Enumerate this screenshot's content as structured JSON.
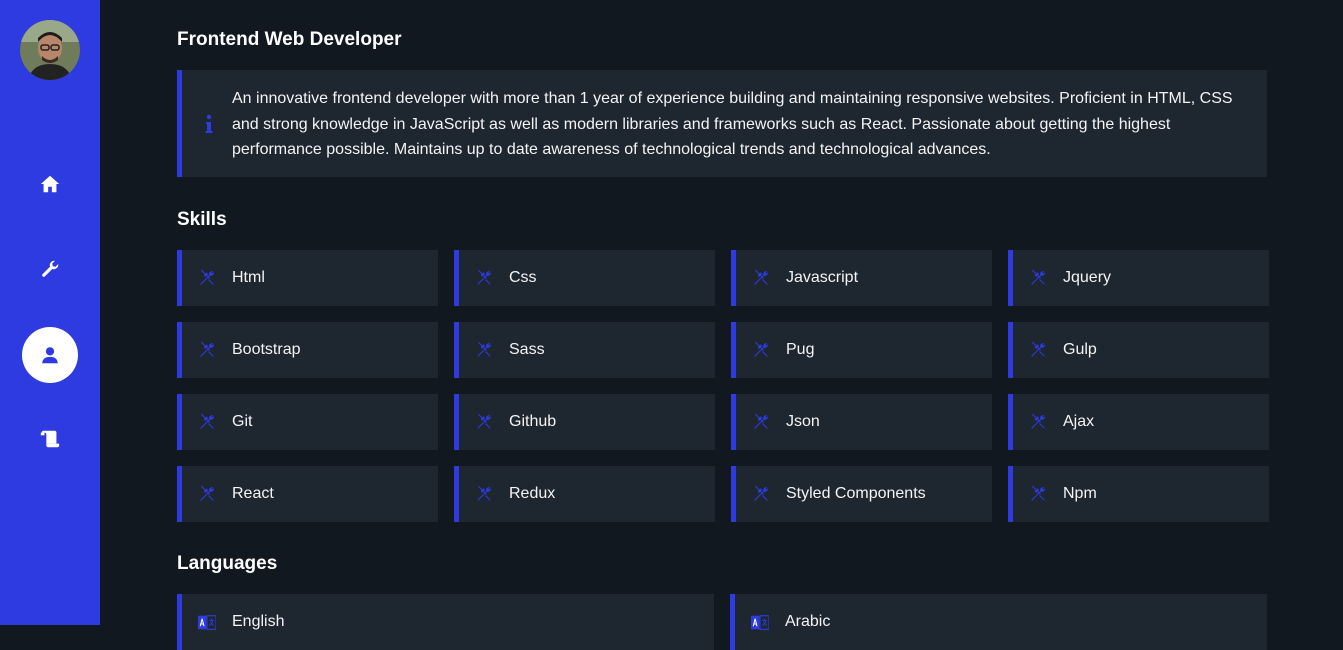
{
  "sidebar": {
    "avatar_alt": "profile photo",
    "nav": [
      {
        "name": "home",
        "icon": "home-icon"
      },
      {
        "name": "skills",
        "icon": "wrench-icon"
      },
      {
        "name": "about",
        "icon": "user-icon",
        "active": true
      },
      {
        "name": "resume",
        "icon": "scroll-icon"
      }
    ]
  },
  "profile": {
    "title": "Frontend Web Developer",
    "about_icon": "info-icon",
    "about_line1": "An innovative frontend developer with more than 1 year of experience building and maintaining responsive websites. Proficient in HTML, CSS",
    "about_line2": "and strong knowledge in JavaScript as well as modern libraries and frameworks such as React. Passionate about getting the highest",
    "about_line3": "performance possible. Maintains up to date awareness of technological trends and technological advances."
  },
  "skills": {
    "heading": "Skills",
    "icon": "tools-icon",
    "items": [
      "Html",
      "Css",
      "Javascript",
      "Jquery",
      "Bootstrap",
      "Sass",
      "Pug",
      "Gulp",
      "Git",
      "Github",
      "Json",
      "Ajax",
      "React",
      "Redux",
      "Styled Components",
      "Npm"
    ]
  },
  "languages": {
    "heading": "Languages",
    "icon": "language-icon",
    "items": [
      "English",
      "Arabic"
    ]
  },
  "colors": {
    "accent": "#2d3be0",
    "background": "#111820",
    "card": "#1e2630"
  }
}
